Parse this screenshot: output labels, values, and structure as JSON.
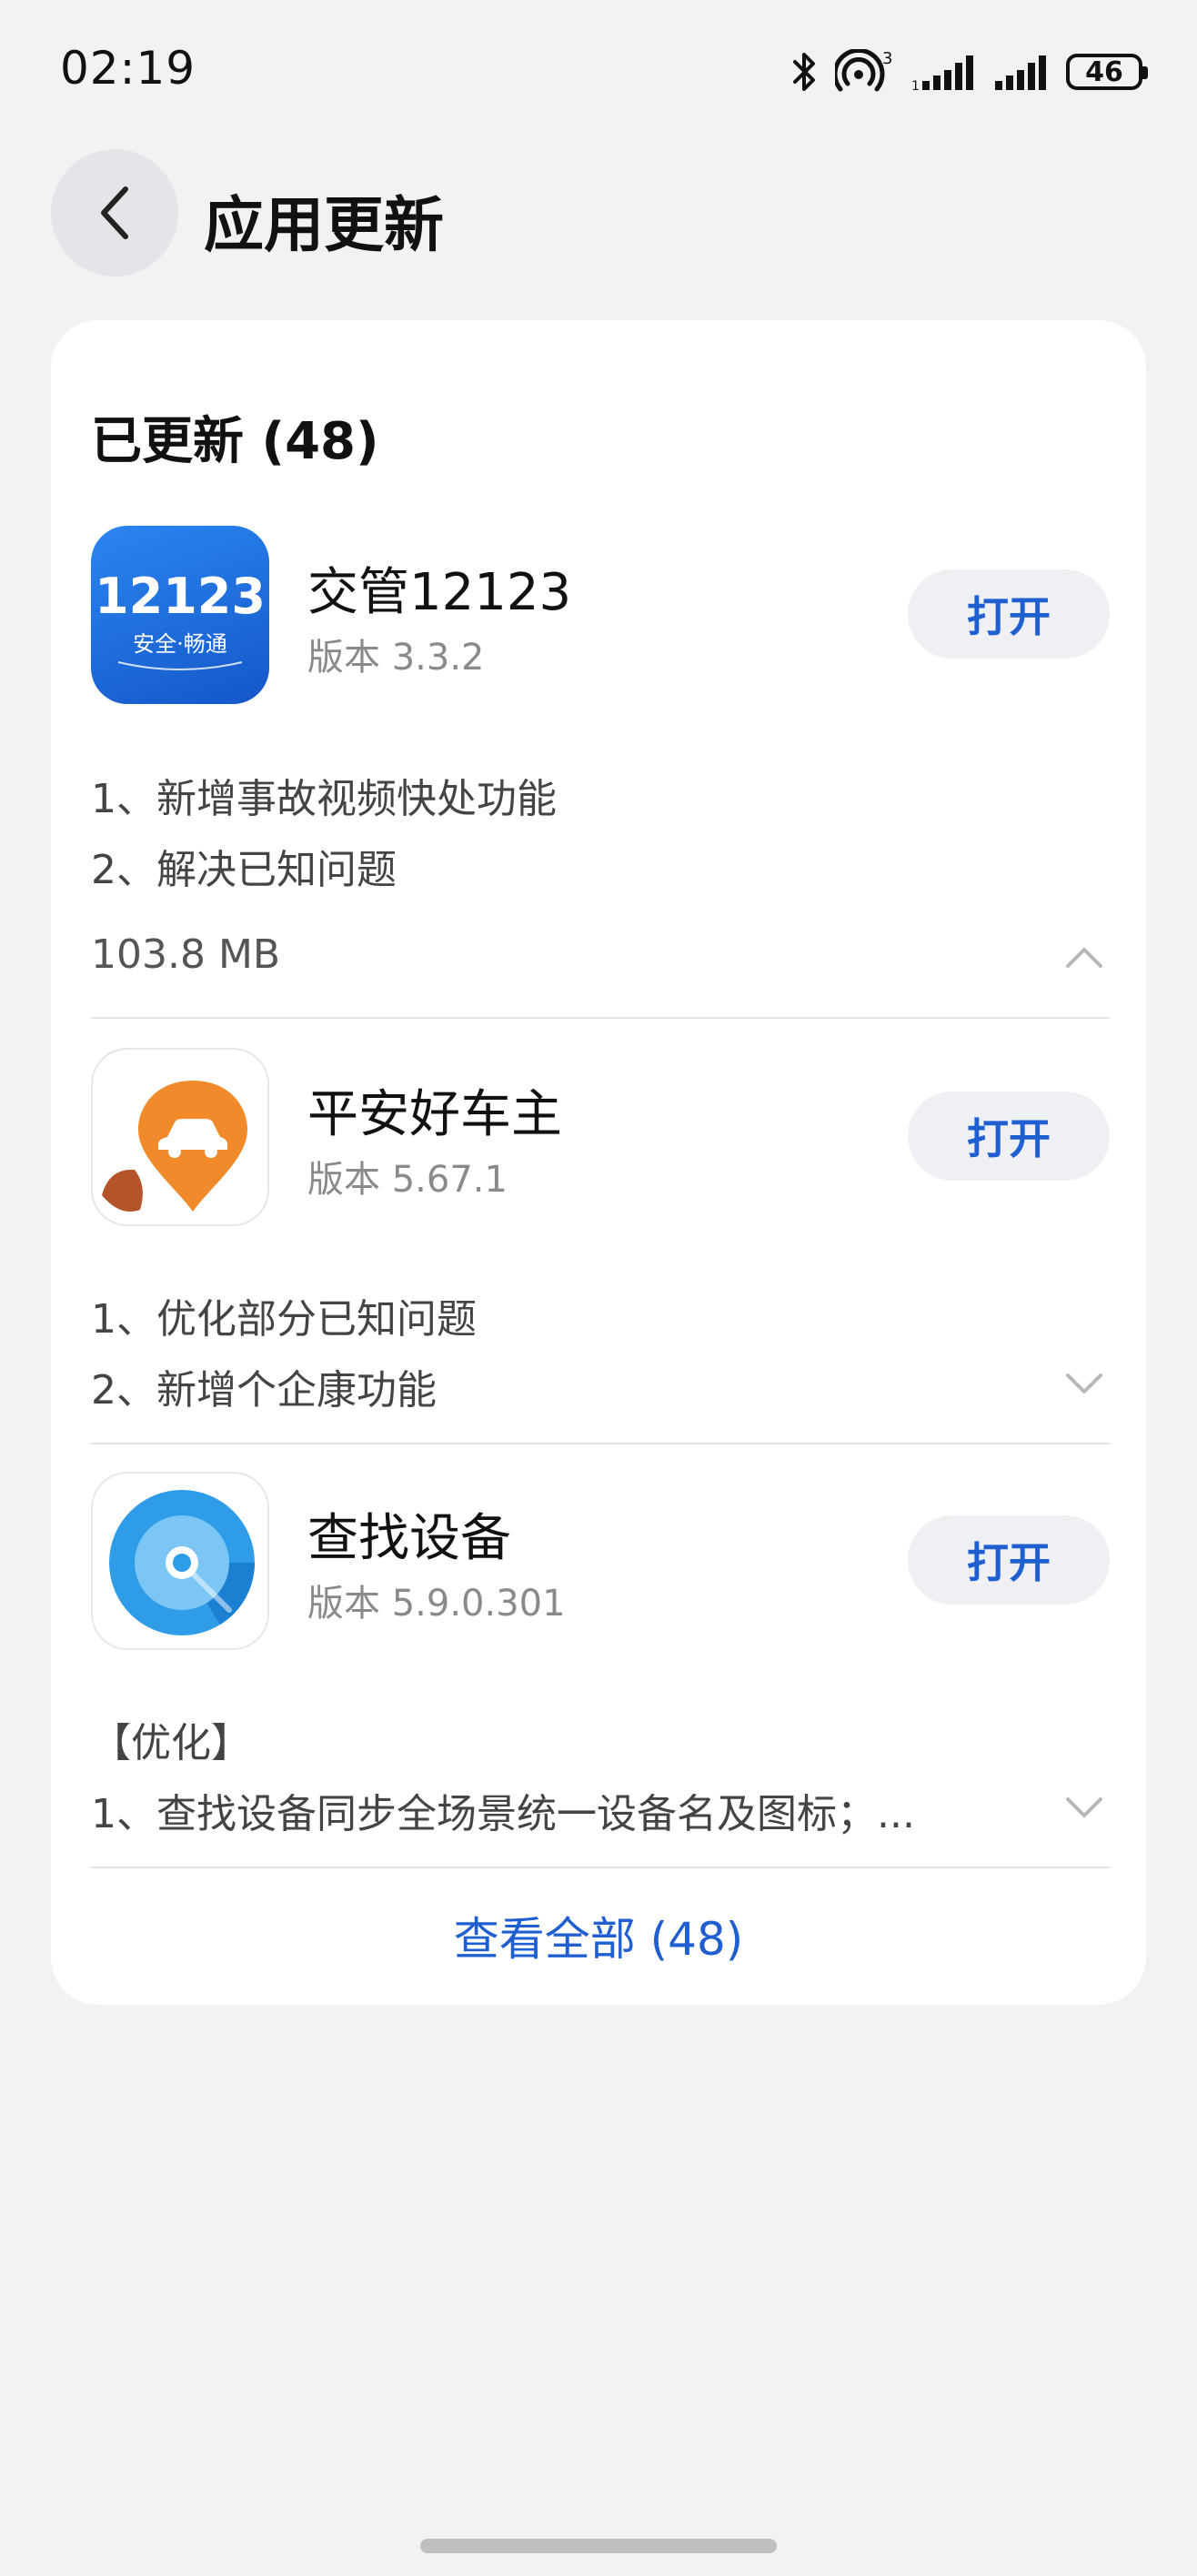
{
  "status_bar": {
    "time": "02:19",
    "battery": "46",
    "hotspot_count": "3"
  },
  "header": {
    "title": "应用更新",
    "back_icon": "chevron-left-icon"
  },
  "section": {
    "title": "已更新 (48)"
  },
  "apps": [
    {
      "name": "交管12123",
      "version": "版本 3.3.2",
      "open_label": "打开",
      "icon_text": "12123",
      "icon_subtext": "安全·畅通",
      "icon_color": "#1d6fe0",
      "notes": [
        "1、新增事故视频快处功能",
        "2、解决已知问题"
      ],
      "size": "103.8 MB",
      "expanded": true
    },
    {
      "name": "平安好车主",
      "version": "版本 5.67.1",
      "open_label": "打开",
      "icon_color": "#f08a2a",
      "notes": [
        "1、优化部分已知问题",
        "2、新增个企康功能"
      ],
      "expanded": false
    },
    {
      "name": "查找设备",
      "version": "版本 5.9.0.301",
      "open_label": "打开",
      "icon_color": "#2f9ce8",
      "notes": [
        "【优化】",
        "1、查找设备同步全场景统一设备名及图标；..."
      ],
      "expanded": false
    }
  ],
  "footer": {
    "view_all_label": "查看全部 (48)"
  },
  "colors": {
    "accent": "#1f5fd1",
    "background": "#f1f2f4",
    "card": "#ffffff"
  }
}
